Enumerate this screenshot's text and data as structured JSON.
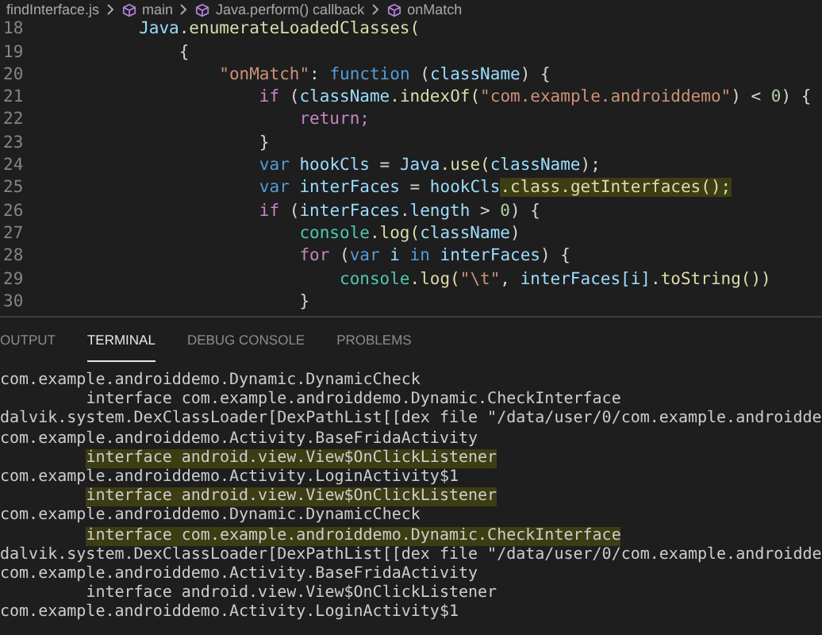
{
  "breadcrumb": [
    {
      "label": "findInterface.js",
      "kind": "file"
    },
    {
      "label": "main",
      "kind": "symbol"
    },
    {
      "label": "Java.perform() callback",
      "kind": "symbol"
    },
    {
      "label": "onMatch",
      "kind": "symbol"
    }
  ],
  "editor": {
    "lines": [
      {
        "number": "18",
        "tokens": [
          {
            "text": "        Java",
            "kind": "variable"
          },
          {
            "text": ".enumerateLoadedClasses(",
            "kind": "function"
          }
        ]
      },
      {
        "number": "19",
        "tokens": [
          {
            "text": "            {",
            "kind": "plain"
          }
        ]
      },
      {
        "number": "20",
        "tokens": [
          {
            "text": "                \"onMatch\"",
            "kind": "string"
          },
          {
            "text": ": ",
            "kind": "plain"
          },
          {
            "text": "function",
            "kind": "keyword"
          },
          {
            "text": " (",
            "kind": "plain"
          },
          {
            "text": "className",
            "kind": "variable"
          },
          {
            "text": ") {",
            "kind": "plain"
          }
        ]
      },
      {
        "number": "21",
        "tokens": [
          {
            "text": "                    if",
            "kind": "control"
          },
          {
            "text": " (",
            "kind": "plain"
          },
          {
            "text": "className",
            "kind": "variable"
          },
          {
            "text": ".indexOf(",
            "kind": "function"
          },
          {
            "text": "\"com.example.androiddemo\"",
            "kind": "string"
          },
          {
            "text": ") < ",
            "kind": "plain"
          },
          {
            "text": "0",
            "kind": "number"
          },
          {
            "text": ") {",
            "kind": "plain"
          }
        ]
      },
      {
        "number": "22",
        "tokens": [
          {
            "text": "                        return;",
            "kind": "control"
          }
        ]
      },
      {
        "number": "23",
        "tokens": [
          {
            "text": "                    }",
            "kind": "plain"
          }
        ]
      },
      {
        "number": "24",
        "tokens": [
          {
            "text": "                    var",
            "kind": "keyword"
          },
          {
            "text": " hookCls",
            "kind": "variable"
          },
          {
            "text": " = ",
            "kind": "plain"
          },
          {
            "text": "Java",
            "kind": "variable"
          },
          {
            "text": ".use(",
            "kind": "function"
          },
          {
            "text": "className",
            "kind": "variable"
          },
          {
            "text": ");",
            "kind": "plain"
          }
        ]
      },
      {
        "number": "25",
        "tokens": [
          {
            "text": "                    var",
            "kind": "keyword"
          },
          {
            "text": " interFaces",
            "kind": "variable"
          },
          {
            "text": " = ",
            "kind": "plain"
          },
          {
            "text": "hookCls",
            "kind": "variable"
          },
          {
            "text": ".class.getInterfaces();",
            "kind": "function",
            "highlight": true
          }
        ]
      },
      {
        "number": "26",
        "tokens": [
          {
            "text": "                    if",
            "kind": "control"
          },
          {
            "text": " (",
            "kind": "plain"
          },
          {
            "text": "interFaces.length",
            "kind": "variable"
          },
          {
            "text": " > ",
            "kind": "plain"
          },
          {
            "text": "0",
            "kind": "number"
          },
          {
            "text": ") {",
            "kind": "plain"
          }
        ]
      },
      {
        "number": "27",
        "tokens": [
          {
            "text": "                        console",
            "kind": "type"
          },
          {
            "text": ".log(",
            "kind": "function"
          },
          {
            "text": "className",
            "kind": "variable"
          },
          {
            "text": ")",
            "kind": "plain"
          }
        ]
      },
      {
        "number": "28",
        "tokens": [
          {
            "text": "                        for",
            "kind": "control"
          },
          {
            "text": " (",
            "kind": "plain"
          },
          {
            "text": "var",
            "kind": "keyword"
          },
          {
            "text": " i",
            "kind": "variable"
          },
          {
            "text": " in",
            "kind": "keyword"
          },
          {
            "text": " interFaces",
            "kind": "variable"
          },
          {
            "text": ") {",
            "kind": "plain"
          }
        ]
      },
      {
        "number": "29",
        "tokens": [
          {
            "text": "                            console",
            "kind": "type"
          },
          {
            "text": ".log(",
            "kind": "function"
          },
          {
            "text": "\"\\t\"",
            "kind": "string"
          },
          {
            "text": ", ",
            "kind": "plain"
          },
          {
            "text": "interFaces[i]",
            "kind": "variable"
          },
          {
            "text": ".toString())",
            "kind": "function"
          }
        ]
      },
      {
        "number": "30",
        "tokens": [
          {
            "text": "                        }",
            "kind": "plain"
          }
        ]
      }
    ]
  },
  "panel_tabs": [
    {
      "label": "OUTPUT",
      "selected": false
    },
    {
      "label": "TERMINAL",
      "selected": true
    },
    {
      "label": "DEBUG CONSOLE",
      "selected": false
    },
    {
      "label": "PROBLEMS",
      "selected": false
    }
  ],
  "terminal": {
    "lines": [
      {
        "text": "com.example.androiddemo.Dynamic.DynamicCheck",
        "highlighted": false
      },
      {
        "text": "         interface com.example.androiddemo.Dynamic.CheckInterface",
        "highlighted": false
      },
      {
        "text": "dalvik.system.DexClassLoader[DexPathList[[dex file \"/data/user/0/com.example.androidde",
        "highlighted": false
      },
      {
        "text": "com.example.androiddemo.Activity.BaseFridaActivity",
        "highlighted": false
      },
      {
        "text": "         interface android.view.View$OnClickListener",
        "highlighted": true
      },
      {
        "text": "com.example.androiddemo.Activity.LoginActivity$1",
        "highlighted": false
      },
      {
        "text": "         interface android.view.View$OnClickListener",
        "highlighted": true
      },
      {
        "text": "com.example.androiddemo.Dynamic.DynamicCheck",
        "highlighted": false
      },
      {
        "text": "         interface com.example.androiddemo.Dynamic.CheckInterface",
        "highlighted": true
      },
      {
        "text": "dalvik.system.DexClassLoader[DexPathList[[dex file \"/data/user/0/com.example.androidde",
        "highlighted": false
      },
      {
        "text": "com.example.androiddemo.Activity.BaseFridaActivity",
        "highlighted": false
      },
      {
        "text": "         interface android.view.View$OnClickListener",
        "highlighted": false
      },
      {
        "text": "com.example.androiddemo.Activity.LoginActivity$1",
        "highlighted": false
      }
    ]
  }
}
